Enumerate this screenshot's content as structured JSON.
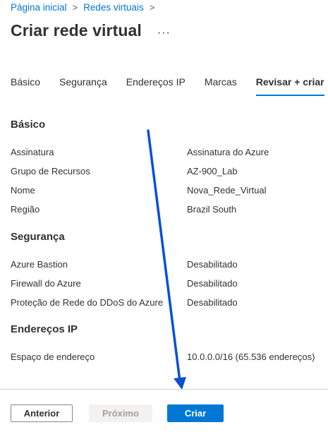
{
  "breadcrumb": {
    "items": [
      "Página inicial",
      "Redes virtuais"
    ],
    "separator": ">"
  },
  "header": {
    "title": "Criar rede virtual",
    "more_label": "···"
  },
  "tabs": [
    {
      "label": "Básico",
      "active": false
    },
    {
      "label": "Segurança",
      "active": false
    },
    {
      "label": "Endereços IP",
      "active": false
    },
    {
      "label": "Marcas",
      "active": false
    },
    {
      "label": "Revisar + criar",
      "active": true
    }
  ],
  "sections": {
    "basics": {
      "title": "Básico",
      "rows": [
        {
          "label": "Assinatura",
          "value": "Assinatura do Azure"
        },
        {
          "label": "Grupo de Recursos",
          "value": "AZ-900_Lab"
        },
        {
          "label": "Nome",
          "value": "Nova_Rede_Virtual"
        },
        {
          "label": "Região",
          "value": "Brazil South"
        }
      ]
    },
    "security": {
      "title": "Segurança",
      "rows": [
        {
          "label": "Azure Bastion",
          "value": "Desabilitado"
        },
        {
          "label": "Firewall do Azure",
          "value": "Desabilitado"
        },
        {
          "label": "Proteção de Rede do DDoS do Azure",
          "value": "Desabilitado"
        }
      ]
    },
    "ip": {
      "title": "Endereços IP",
      "rows": [
        {
          "label": "Espaço de endereço",
          "value": "10.0.0.0/16 (65.536 endereços)"
        }
      ]
    }
  },
  "footer": {
    "previous_label": "Anterior",
    "next_label": "Próximo",
    "create_label": "Criar"
  },
  "colors": {
    "accent": "#0078d4",
    "annotation_arrow": "#0a4fd6"
  }
}
